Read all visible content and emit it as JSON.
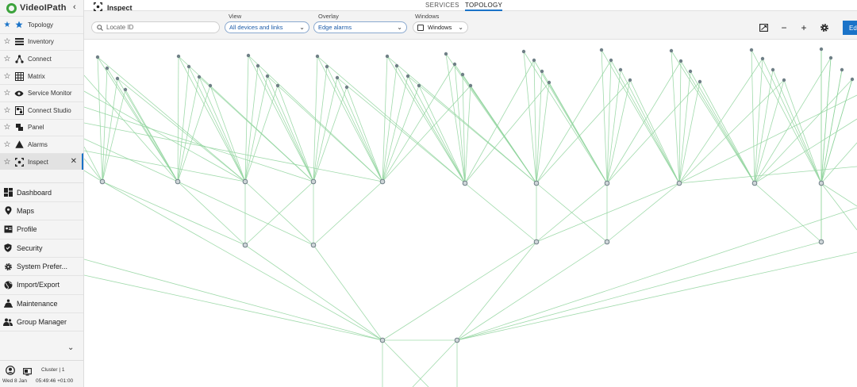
{
  "app": {
    "logo_text": "VideoIPath"
  },
  "favorites": [
    {
      "label": "Topology",
      "starred": true,
      "icon": "star-topology-icon"
    },
    {
      "label": "Inventory",
      "starred": false,
      "icon": "list-icon"
    },
    {
      "label": "Connect",
      "starred": false,
      "icon": "connect-icon"
    },
    {
      "label": "Matrix",
      "starred": false,
      "icon": "grid-icon"
    },
    {
      "label": "Service Monitor",
      "starred": false,
      "icon": "eye-icon"
    },
    {
      "label": "Connect Studio",
      "starred": false,
      "icon": "studio-icon"
    },
    {
      "label": "Panel",
      "starred": false,
      "icon": "panel-icon"
    },
    {
      "label": "Alarms",
      "starred": false,
      "icon": "warning-icon"
    },
    {
      "label": "Inspect",
      "starred": false,
      "icon": "inspect-icon",
      "active": true
    }
  ],
  "nav": [
    {
      "label": "Dashboard",
      "icon": "dashboard-icon"
    },
    {
      "label": "Maps",
      "icon": "map-pin-icon"
    },
    {
      "label": "Profile",
      "icon": "profile-icon"
    },
    {
      "label": "Security",
      "icon": "shield-icon"
    },
    {
      "label": "System Prefer...",
      "icon": "gear-icon"
    },
    {
      "label": "Import/Export",
      "icon": "globe-icon"
    },
    {
      "label": "Maintenance",
      "icon": "maintenance-icon"
    },
    {
      "label": "Group Manager",
      "icon": "group-icon"
    }
  ],
  "footer": {
    "cluster": "Cluster | 1",
    "date": "Wed 8 Jan",
    "time": "05:49:46 +01:00"
  },
  "header": {
    "title": "Inspect",
    "tabs": [
      {
        "label": "SERVICES",
        "active": false
      },
      {
        "label": "TOPOLOGY",
        "active": true
      }
    ]
  },
  "toolbar": {
    "search_placeholder": "Locate ID",
    "view_label": "View",
    "view_value": "All devices and links",
    "overlay_label": "Overlay",
    "overlay_value": "Edge alarms",
    "windows_label": "Windows",
    "windows_value": "Windows",
    "edit_label": "Ed"
  },
  "colors": {
    "accent": "#1a73c8",
    "link": "#8fd49c",
    "node": "#6f7f86"
  }
}
